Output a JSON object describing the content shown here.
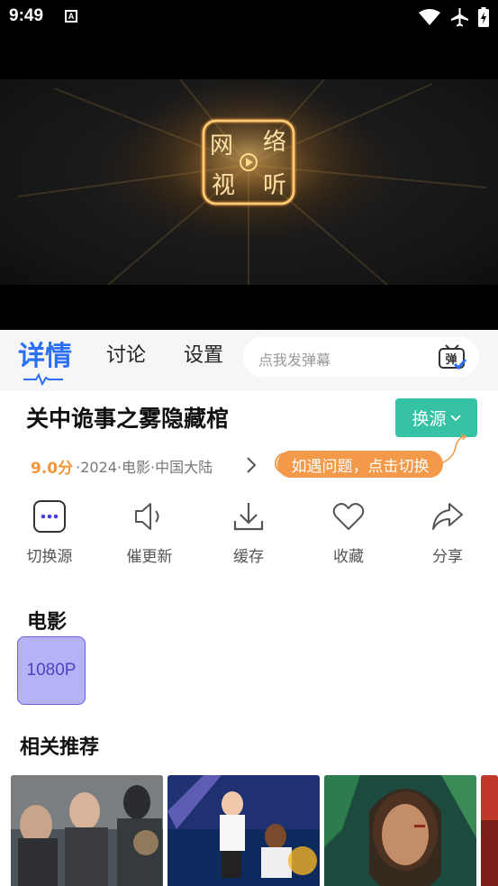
{
  "status_bar": {
    "time": "9:49",
    "notif_glyph": "A",
    "icons": [
      "wifi-icon",
      "airplane-icon",
      "battery-charging-icon"
    ]
  },
  "video": {
    "logo_chars": [
      "网",
      "络",
      "视",
      "听"
    ]
  },
  "tabs": {
    "detail": "详情",
    "discuss": "讨论",
    "settings": "设置",
    "active": "detail"
  },
  "danmu": {
    "placeholder": "点我发弹幕",
    "icon_label": "弹"
  },
  "movie": {
    "title": "关中诡事之雾隐藏棺",
    "score": "9.0分",
    "meta": "·2024·电影·中国大陆",
    "switch_label": "换源",
    "tip": "如遇问题，点击切换"
  },
  "actions": [
    {
      "label": "切换源",
      "icon": "switch-source-icon"
    },
    {
      "label": "催更新",
      "icon": "speaker-icon"
    },
    {
      "label": "缓存",
      "icon": "download-icon"
    },
    {
      "label": "收藏",
      "icon": "heart-icon"
    },
    {
      "label": "分享",
      "icon": "share-icon"
    }
  ],
  "episodes": {
    "title": "电影",
    "items": [
      "1080P"
    ]
  },
  "recommend": {
    "title": "相关推荐"
  },
  "colors": {
    "accent_blue": "#2d6ff3",
    "switch_green": "#36c2a5",
    "score_orange": "#f29637",
    "tip_orange": "#f3994a",
    "chip_bg": "#b5b2f6"
  }
}
